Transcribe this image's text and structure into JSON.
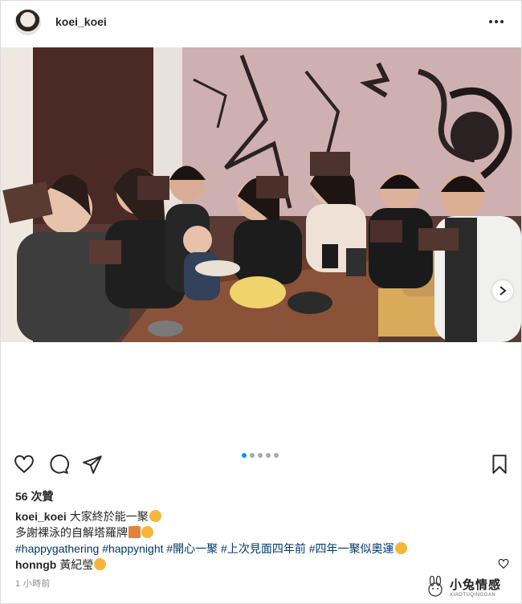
{
  "post": {
    "username": "koei_koei",
    "likes": "56 次贊",
    "caption_user": "koei_koei",
    "caption_line1": "大家終於能一聚",
    "caption_line2": "多謝裸泳的自解塔羅牌",
    "hashtags": "#happygathering #happynight #開心一聚 #上次見面四年前 #四年一聚似奧運",
    "comment_user": "honngb",
    "comment_text": "黃紀瑩",
    "time": "1 小時前"
  },
  "carousel": {
    "count": 5,
    "active_index": 0
  },
  "watermark": {
    "cn": "小兔情感",
    "en": "XIAOTUQINGGAN"
  },
  "colors": {
    "link": "#00376b",
    "dot_active": "#0095f6",
    "dot_inactive": "#a8a8a8",
    "text": "#262626",
    "muted": "#8e8e8e"
  },
  "icons": [
    "more-options-icon",
    "heart-icon",
    "comment-icon",
    "share-icon",
    "bookmark-icon",
    "next-arrow-icon"
  ]
}
